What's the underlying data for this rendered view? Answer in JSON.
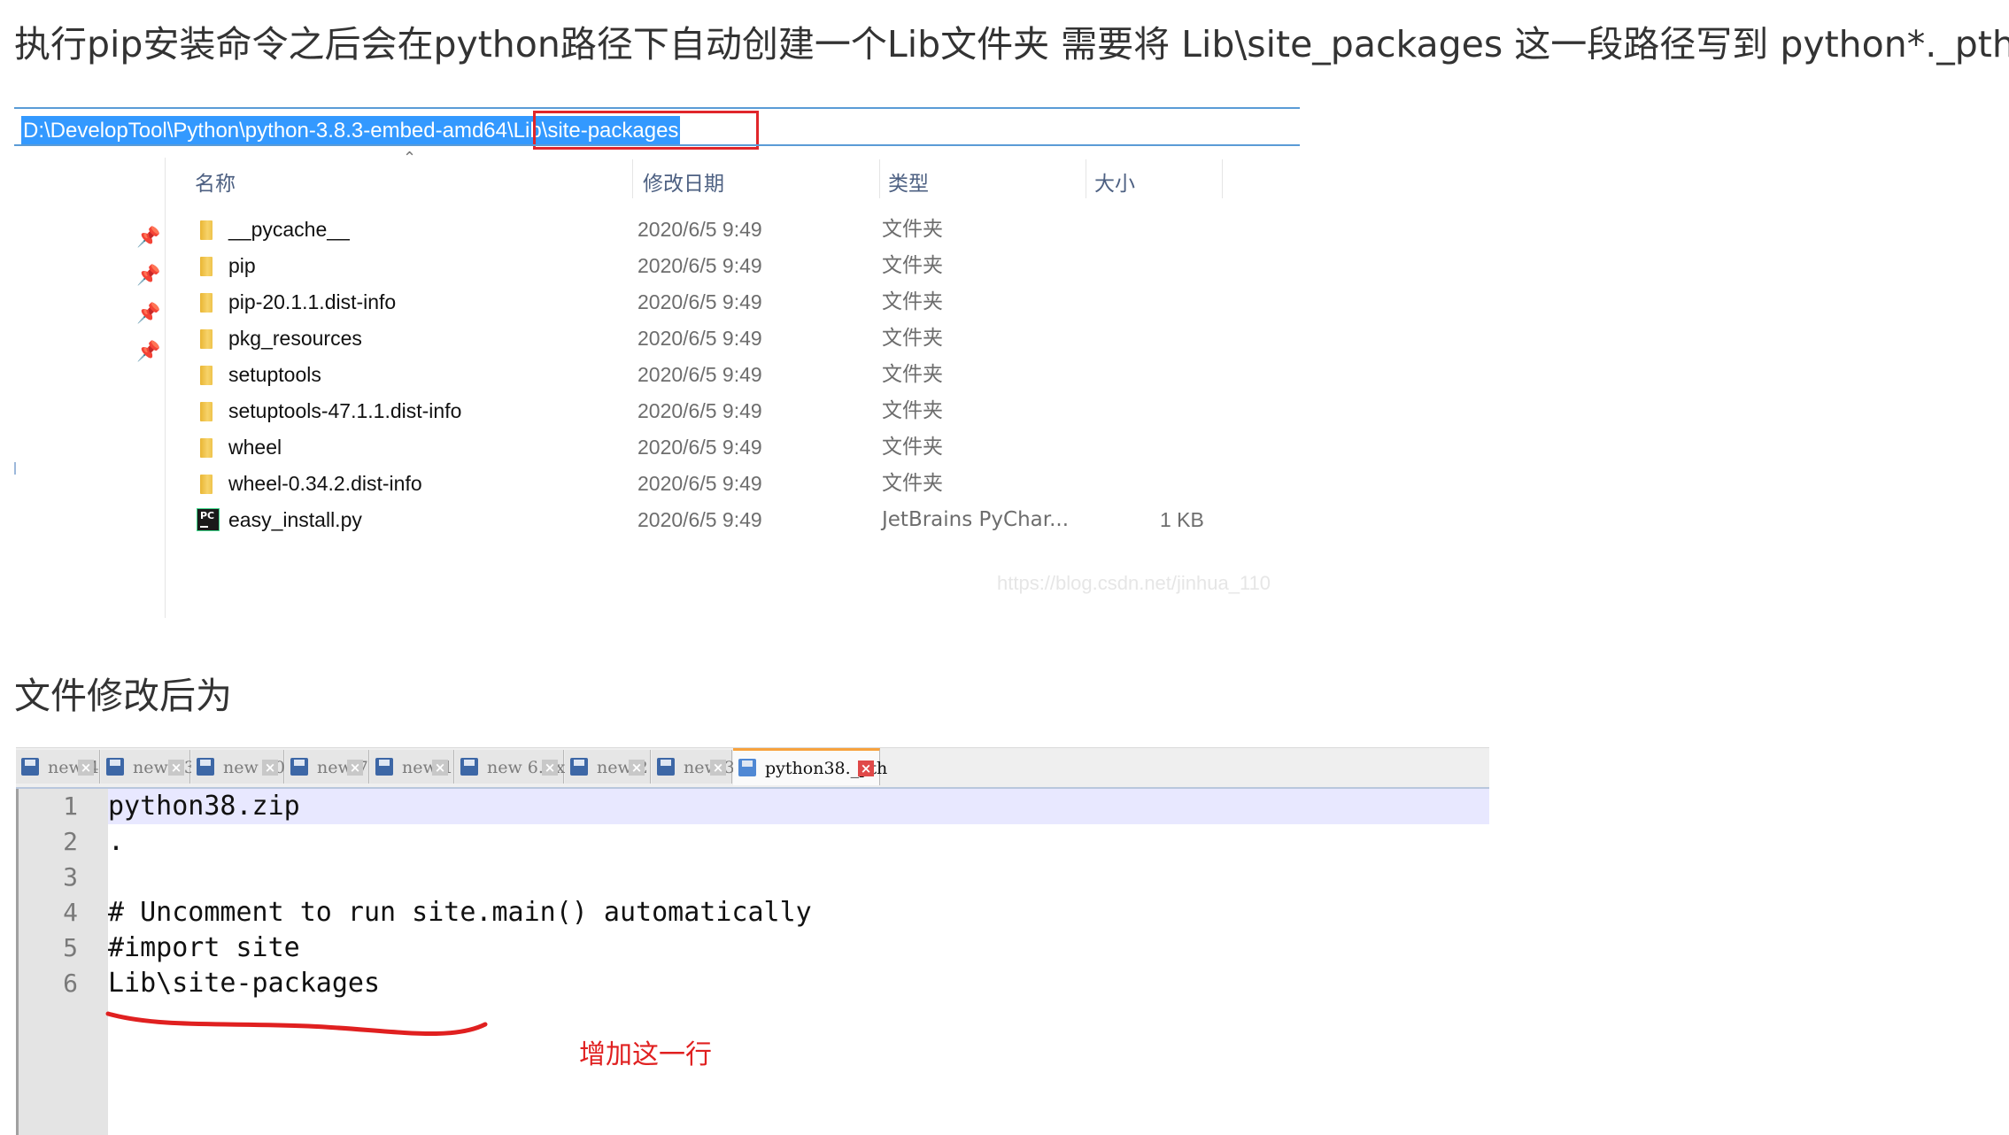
{
  "heading_top": "执行pip安装命令之后会在python路径下自动创建一个Lib文件夹  需要将  Lib\\site_packages  这一段路径写到 python*._pth中",
  "heading_mid": "文件修改后为",
  "explorer": {
    "address": "D:\\DevelopTool\\Python\\python-3.8.3-embed-amd64\\Lib\\site-packages",
    "columns": {
      "name": "名称",
      "date": "修改日期",
      "type": "类型",
      "size": "大小"
    },
    "files": [
      {
        "name": "__pycache__",
        "date": "2020/6/5 9:49",
        "type": "文件夹",
        "size": "",
        "icon": "folder-icon"
      },
      {
        "name": "pip",
        "date": "2020/6/5 9:49",
        "type": "文件夹",
        "size": "",
        "icon": "folder-icon"
      },
      {
        "name": "pip-20.1.1.dist-info",
        "date": "2020/6/5 9:49",
        "type": "文件夹",
        "size": "",
        "icon": "folder-icon"
      },
      {
        "name": "pkg_resources",
        "date": "2020/6/5 9:49",
        "type": "文件夹",
        "size": "",
        "icon": "folder-icon"
      },
      {
        "name": "setuptools",
        "date": "2020/6/5 9:49",
        "type": "文件夹",
        "size": "",
        "icon": "folder-icon"
      },
      {
        "name": "setuptools-47.1.1.dist-info",
        "date": "2020/6/5 9:49",
        "type": "文件夹",
        "size": "",
        "icon": "folder-icon"
      },
      {
        "name": "wheel",
        "date": "2020/6/5 9:49",
        "type": "文件夹",
        "size": "",
        "icon": "folder-icon"
      },
      {
        "name": "wheel-0.34.2.dist-info",
        "date": "2020/6/5 9:49",
        "type": "文件夹",
        "size": "",
        "icon": "folder-icon"
      },
      {
        "name": "easy_install.py",
        "date": "2020/6/5 9:49",
        "type": "JetBrains PyChar...",
        "size": "1 KB",
        "icon": "pycharm-file-icon"
      }
    ],
    "watermark": "https://blog.csdn.net/jinhua_110",
    "pycharm_badge": "PC"
  },
  "notepad": {
    "tabs": [
      {
        "label": "new 4",
        "active": false
      },
      {
        "label": "new 13",
        "active": false
      },
      {
        "label": "new 10",
        "active": false
      },
      {
        "label": "new 7",
        "active": false
      },
      {
        "label": "new 1",
        "active": false
      },
      {
        "label": "new 6. txt",
        "active": false
      },
      {
        "label": "new 2",
        "active": false
      },
      {
        "label": "new 3",
        "active": false
      },
      {
        "label": "python38._pth",
        "active": true
      }
    ],
    "close_glyph": "×",
    "lines": [
      {
        "num": "1",
        "text": "python38.zip"
      },
      {
        "num": "2",
        "text": "."
      },
      {
        "num": "3",
        "text": ""
      },
      {
        "num": "4",
        "text": "# Uncomment to run site.main() automatically"
      },
      {
        "num": "5",
        "text": "#import site"
      },
      {
        "num": "6",
        "text": "Lib\\site-packages"
      }
    ],
    "annotation": "增加这一行"
  },
  "colors": {
    "address_highlight": "#3399ff",
    "red_annotation": "#e02020",
    "current_line": "#e8e8ff",
    "active_tab_accent": "#f7a23e"
  }
}
